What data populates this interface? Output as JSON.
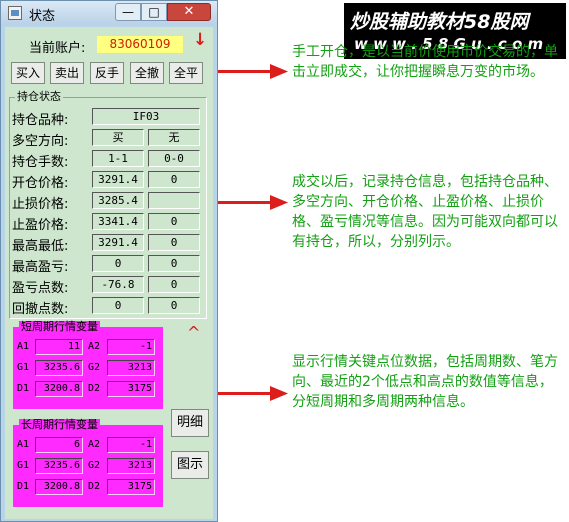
{
  "window": {
    "title": "状态",
    "min_glyph": "—",
    "max_glyph": "□",
    "close_glyph": "✕"
  },
  "account": {
    "label": "当前账户:",
    "value": "83060109",
    "indicator": "↓"
  },
  "actions": [
    "买入",
    "卖出",
    "反手",
    "全撤",
    "全平"
  ],
  "position": {
    "group_title": "持仓状态",
    "rows": [
      {
        "label": "持仓品种:",
        "v1": "IF03",
        "v2": null
      },
      {
        "label": "多空方向:",
        "v1": "买",
        "v2": "无"
      },
      {
        "label": "持仓手数:",
        "v1": "1-1",
        "v2": "0-0"
      },
      {
        "label": "开仓价格:",
        "v1": "3291.4",
        "v2": "0"
      },
      {
        "label": "止损价格:",
        "v1": "3285.4",
        "v2": ""
      },
      {
        "label": "止盈价格:",
        "v1": "3341.4",
        "v2": "0"
      },
      {
        "label": "最高最低:",
        "v1": "3291.4",
        "v2": "0"
      },
      {
        "label": "最高盈亏:",
        "v1": "0",
        "v2": "0"
      },
      {
        "label": "盈亏点数:",
        "v1": "-76.8",
        "v2": "0"
      },
      {
        "label": "回撤点数:",
        "v1": "0",
        "v2": "0"
      }
    ]
  },
  "short_period": {
    "title": "短周期行情变量",
    "cells": [
      {
        "label": "A1",
        "value": "11"
      },
      {
        "label": "A2",
        "value": "-1"
      },
      {
        "label": "G1",
        "value": "3235.6"
      },
      {
        "label": "G2",
        "value": "3213"
      },
      {
        "label": "D1",
        "value": "3200.8"
      },
      {
        "label": "D2",
        "value": "3175"
      }
    ]
  },
  "long_period": {
    "title": "长周期行情变量",
    "cells": [
      {
        "label": "A1",
        "value": "6"
      },
      {
        "label": "A2",
        "value": "-1"
      },
      {
        "label": "G1",
        "value": "3235.6"
      },
      {
        "label": "G2",
        "value": "3213"
      },
      {
        "label": "D1",
        "value": "3200.8"
      },
      {
        "label": "D2",
        "value": "3175"
      }
    ]
  },
  "caret": "^",
  "side_buttons": [
    "明细",
    "图示"
  ],
  "watermark": {
    "line1": "炒股辅助教材58股网",
    "line2": "w w w . 5 8 G u . c o m"
  },
  "annotations": [
    "手工开仓，是以当前价使用市价交易的，单击立即成交，让你把握瞬息万变的市场。",
    "成交以后，记录持仓信息，包括持仓品种、多空方向、开仓价格、止盈价格、止损价格、盈亏情况等信息。因为可能双向都可以有持仓，所以，分别列示。",
    "显示行情关键点位数据，包括周期数、笔方向、最近的2个低点和高点的数值等信息，分短周期和多周期两种信息。"
  ],
  "colors": {
    "panel_green": "#cde6cd",
    "magenta_panel": "#ff2aff",
    "annotation_text": "#13a013",
    "arrow": "#dd1c1c",
    "account_value_bg": "#ffff80",
    "account_value_text": "#cc2200"
  }
}
